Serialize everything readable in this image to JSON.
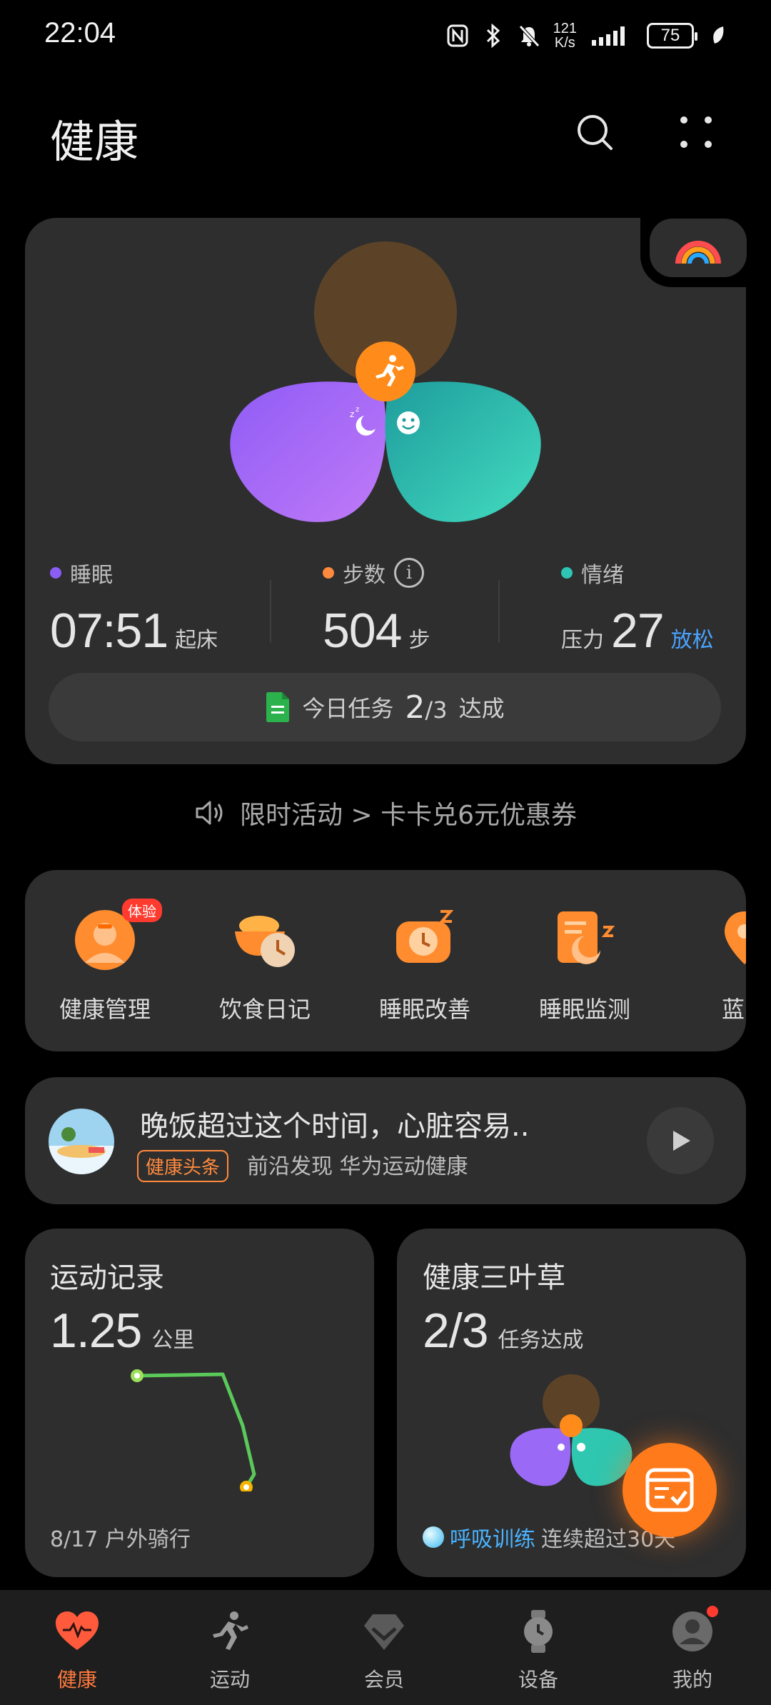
{
  "status_bar": {
    "time": "22:04",
    "net_speed_top": "121",
    "net_speed_bottom": "K/s",
    "battery": "75",
    "icons": [
      "nfc-icon",
      "bluetooth-icon",
      "mute-icon",
      "signal-icon",
      "battery-icon",
      "leaf-icon"
    ]
  },
  "header": {
    "title": "健康",
    "icons": [
      "search-icon",
      "more-icon"
    ]
  },
  "overview": {
    "sleep": {
      "label": "睡眠",
      "value": "07:51",
      "unit": "起床",
      "color": "#8b5cf6"
    },
    "steps": {
      "label": "步数",
      "value": "504",
      "unit": "步",
      "color": "#ff8a3d",
      "info": "i"
    },
    "mood": {
      "label": "情绪",
      "prefix": "压力",
      "value": "27",
      "status": "放松",
      "color": "#2ec4b6"
    },
    "task": {
      "prefix": "今日任务",
      "done": "2",
      "total": "/3",
      "suffix": "达成"
    }
  },
  "promo": {
    "text": "限时活动 > 卡卡兑6元优惠券"
  },
  "services": [
    {
      "label": "健康管理",
      "badge": "体验",
      "icon": "health-manage-icon"
    },
    {
      "label": "饮食日记",
      "icon": "diet-diary-icon"
    },
    {
      "label": "睡眠改善",
      "icon": "sleep-improve-icon"
    },
    {
      "label": "睡眠监测",
      "icon": "sleep-monitor-icon"
    },
    {
      "label": "蓝星",
      "icon": "map-pin-icon"
    }
  ],
  "news": {
    "title": "晚饭超过这个时间，心脏容易..",
    "tag": "健康头条",
    "source": "前沿发现 华为运动健康"
  },
  "exercise": {
    "title": "运动记录",
    "value": "1.25",
    "unit": "公里",
    "footer": "8/17 户外骑行"
  },
  "clover": {
    "title": "健康三叶草",
    "value": "2/3",
    "unit": "任务达成",
    "footer_highlight": "呼吸训练",
    "footer_rest": "连续超过30天"
  },
  "tabs": [
    {
      "label": "健康",
      "icon": "heart-pulse-icon",
      "active": true
    },
    {
      "label": "运动",
      "icon": "running-icon"
    },
    {
      "label": "会员",
      "icon": "diamond-icon"
    },
    {
      "label": "设备",
      "icon": "watch-icon"
    },
    {
      "label": "我的",
      "icon": "profile-icon"
    }
  ]
}
